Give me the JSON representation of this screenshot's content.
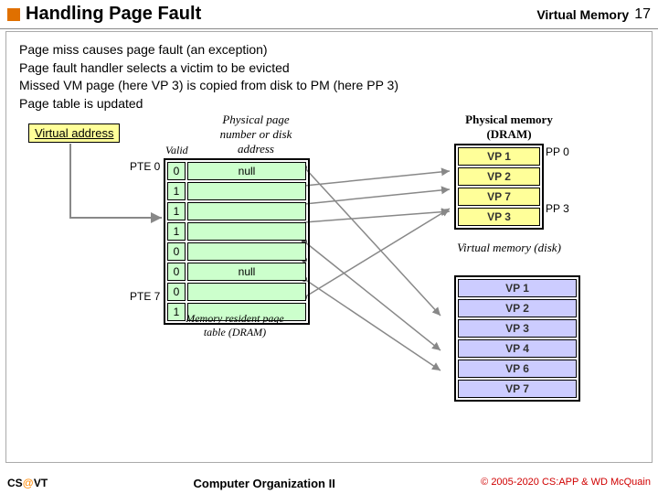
{
  "header": {
    "title": "Handling Page Fault",
    "rt": "Virtual Memory",
    "pg": "17"
  },
  "bullets": {
    "b1": "Page miss causes page fault (an exception)",
    "b2": "Page fault handler selects a victim to be evicted",
    "b3": "Missed VM page (here VP 3) is copied from disk to PM (here PP 3)",
    "b4": "Page table is updated"
  },
  "va": "Virtual address",
  "ptheader": "Physical page number or disk address",
  "valid": "Valid",
  "pte0": "PTE 0",
  "pte7": "PTE 7",
  "pt": [
    {
      "v": "0",
      "a": "null"
    },
    {
      "v": "1",
      "a": ""
    },
    {
      "v": "1",
      "a": ""
    },
    {
      "v": "1",
      "a": ""
    },
    {
      "v": "0",
      "a": ""
    },
    {
      "v": "0",
      "a": "null"
    },
    {
      "v": "0",
      "a": ""
    },
    {
      "v": "1",
      "a": ""
    }
  ],
  "mrpt": "Memory resident page table (DRAM)",
  "pmlbl": "Physical memory (DRAM)",
  "pm": [
    "VP 1",
    "VP 2",
    "VP 7",
    "VP 3"
  ],
  "pp0": "PP 0",
  "pp3": "PP 3",
  "vmlbl": "Virtual memory (disk)",
  "vm": [
    "VP 1",
    "VP 2",
    "VP 3",
    "VP 4",
    "VP 6",
    "VP 7"
  ],
  "footer": {
    "l1": "CS",
    "l2": "@",
    "l3": "VT",
    "c": "Computer Organization II",
    "r": "© 2005-2020 CS:APP & WD McQuain"
  }
}
